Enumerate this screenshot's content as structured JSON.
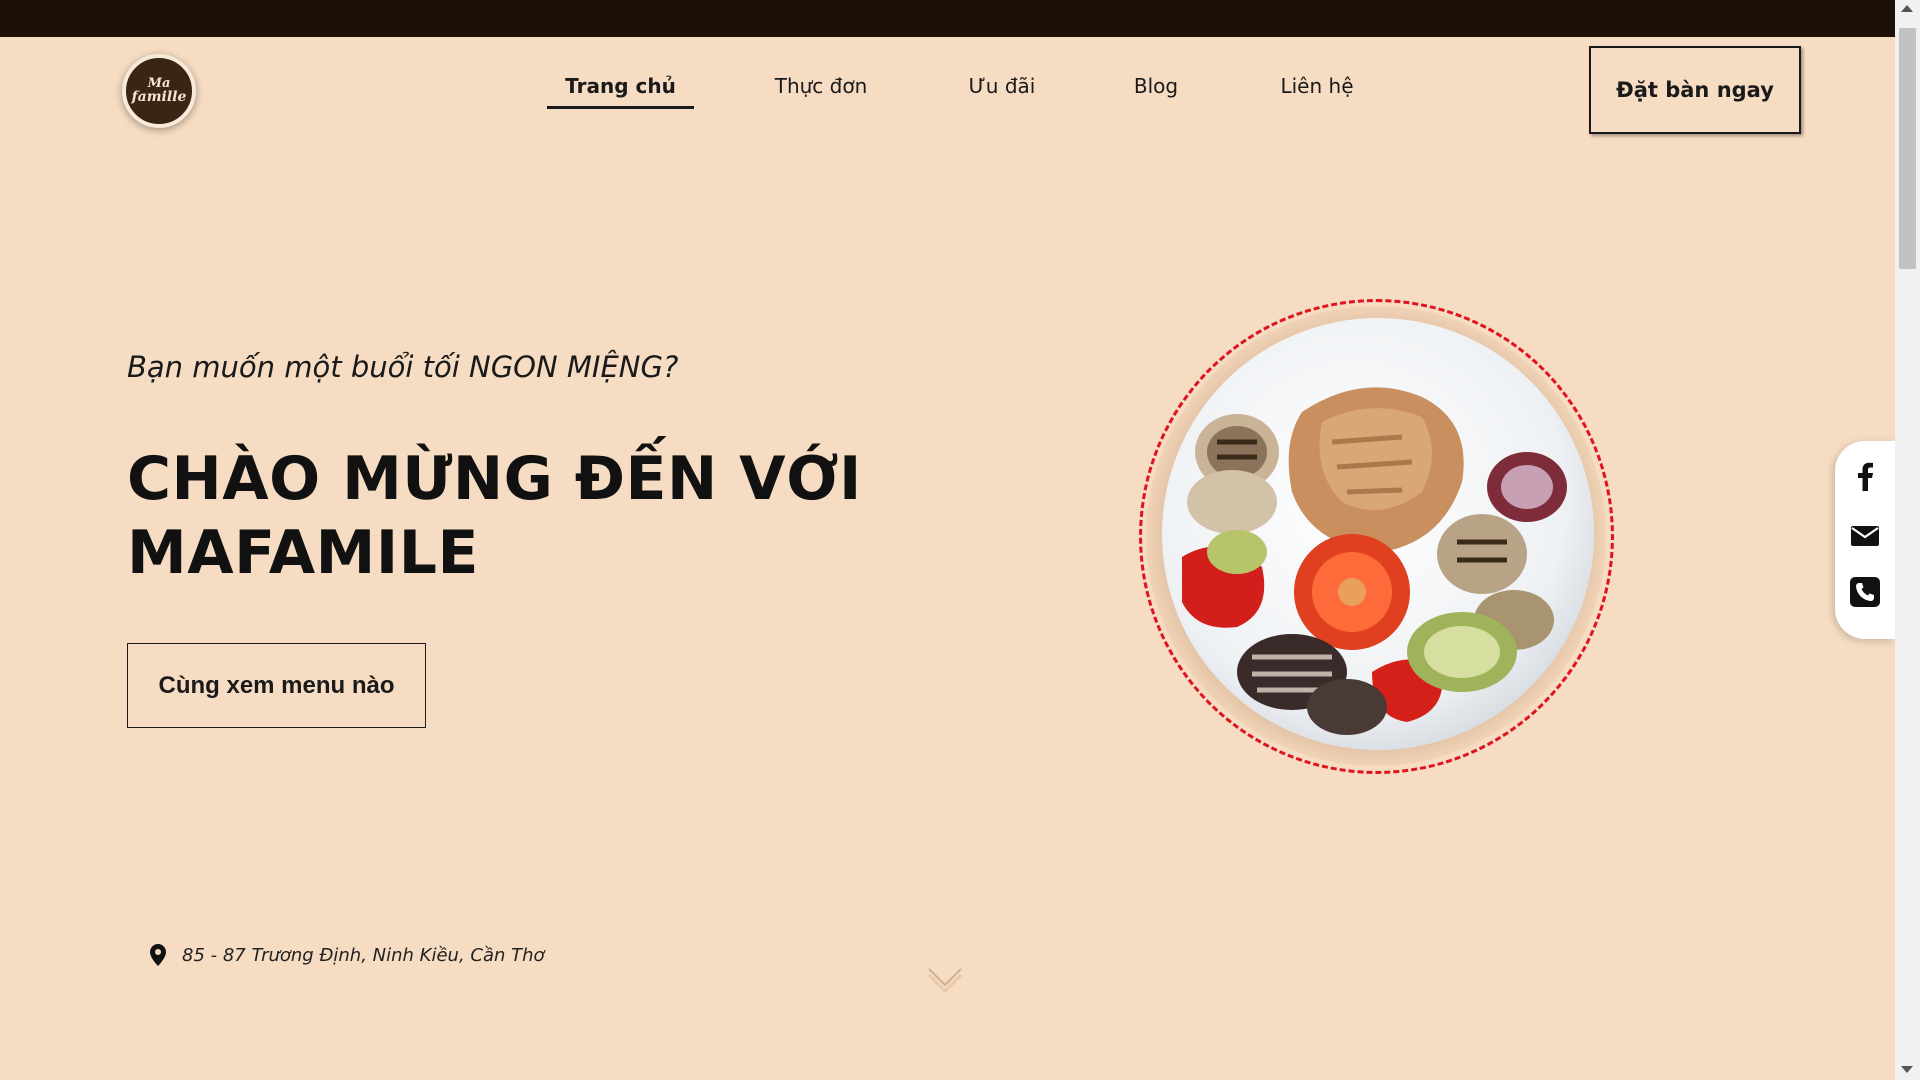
{
  "brand": {
    "logo_line1": "Ma",
    "logo_line2": "famille",
    "colors": {
      "background": "#f5dcc2",
      "topbar": "#1e1006",
      "text": "#1a1a1a",
      "plate_border": "#e0141e"
    }
  },
  "nav": {
    "items": [
      {
        "label": "Trang chủ",
        "active": true
      },
      {
        "label": "Thực đơn",
        "active": false
      },
      {
        "label": "Ưu đãi",
        "active": false
      },
      {
        "label": "Blog",
        "active": false
      },
      {
        "label": "Liên hệ",
        "active": false
      }
    ],
    "book_button": "Đặt bàn ngay"
  },
  "hero": {
    "subtitle": "Bạn muốn một buổi tối NGON MIỆNG?",
    "headline_line1": "CHÀO MỪNG ĐẾN VỚI",
    "headline_line2": "MAFAMILE",
    "cta_button": "Cùng xem menu nào",
    "image_icon": "grilled-food-plate"
  },
  "address": {
    "icon": "location-pin-icon",
    "text": "85 - 87 Trương Định, Ninh Kiều, Cần Thơ"
  },
  "social": {
    "items": [
      "facebook-icon",
      "mail-icon",
      "phone-icon"
    ]
  }
}
